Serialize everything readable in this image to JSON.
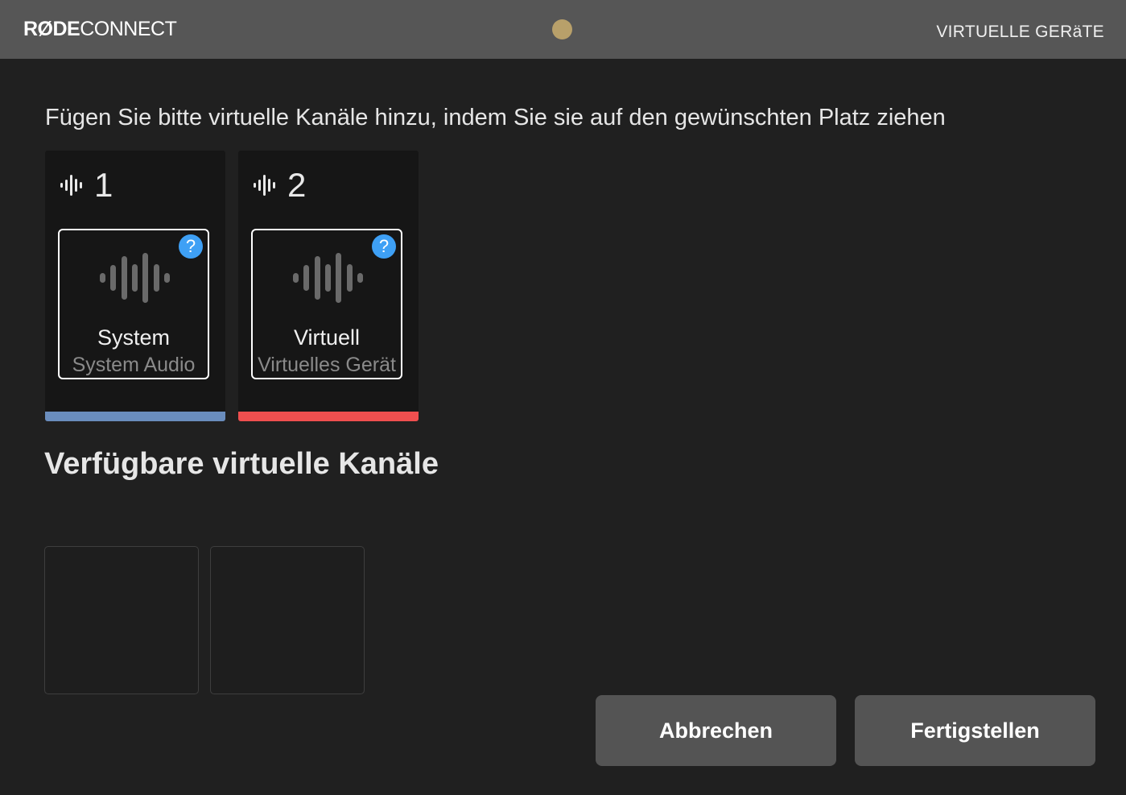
{
  "header": {
    "logo_brand": "RØDE",
    "logo_product": "CONNECT",
    "title": "VIRTUELLE GERäTE"
  },
  "instruction": "Fügen Sie bitte virtuelle Kanäle hinzu, indem Sie sie auf den gewünschten Platz ziehen",
  "channels": [
    {
      "number": "1",
      "name": "System",
      "sub": "System Audio",
      "help": "?",
      "color": "#6a8dbd"
    },
    {
      "number": "2",
      "name": "Virtuell",
      "sub": "Virtuelles Gerät",
      "help": "?",
      "color": "#ef4f4f"
    }
  ],
  "available_title": "Verfügbare virtuelle Kanäle",
  "buttons": {
    "cancel": "Abbrechen",
    "finish": "Fertigstellen"
  },
  "colors": {
    "status_dot": "#b8a06a",
    "help_badge": "#3ea0f5"
  }
}
